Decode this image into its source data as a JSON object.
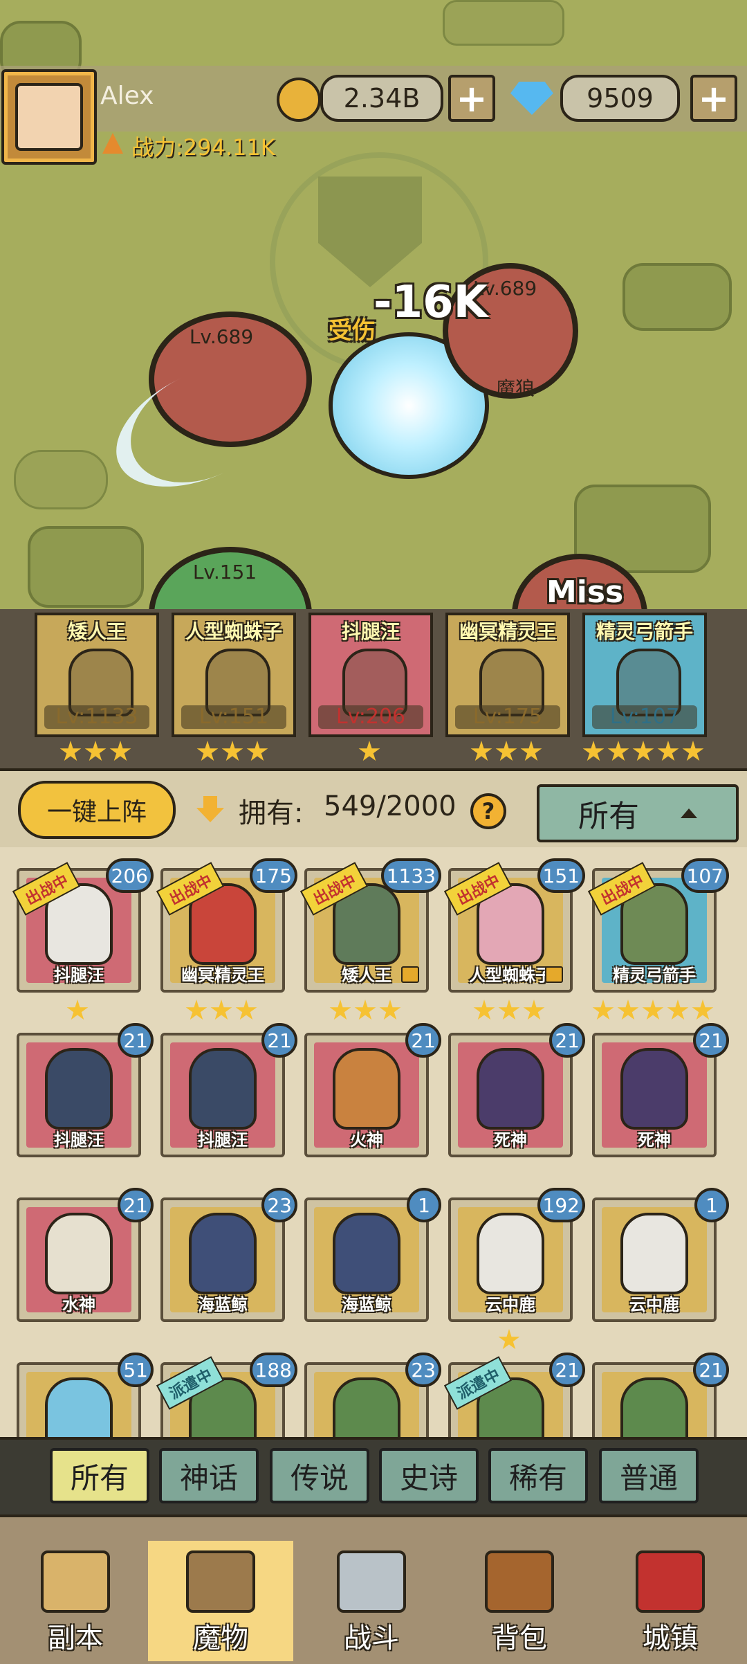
{
  "player": {
    "name": "Alex",
    "power_label": "战力:294.11K",
    "gold": "2.34B",
    "gems": "9509",
    "plus": "+"
  },
  "battle": {
    "enemy_levels": [
      "Lv.689",
      "Lv.689",
      "Lv.689"
    ],
    "damage_text": "-16K",
    "damage_prefix": "受伤",
    "miss_text": "Miss",
    "enemy_label": "魔狼",
    "ally_level": "Lv.151"
  },
  "formation": [
    {
      "name": "矮人王",
      "level": "Lv:1133",
      "stars": 3,
      "color": "#c7a85a"
    },
    {
      "name": "人型蜘蛛子",
      "level": "Lv:151",
      "stars": 3,
      "color": "#c7a85a"
    },
    {
      "name": "抖腿汪",
      "level": "Lv:206",
      "stars": 1,
      "color": "#cf6a74"
    },
    {
      "name": "幽冥精灵王",
      "level": "Lv:175",
      "stars": 3,
      "color": "#c7a85a"
    },
    {
      "name": "精灵弓箭手",
      "level": "Lv:107",
      "stars": 5,
      "color": "#5eb3c8"
    }
  ],
  "controls": {
    "deploy_label": "一键上阵",
    "owned_label": "拥有:",
    "owned_value": "549/2000",
    "help": "?",
    "filter_label": "所有"
  },
  "monsters": [
    {
      "name": "抖腿汪",
      "level": "206",
      "ribbon": "出战中",
      "stars": 1,
      "bg": "#cf6a74",
      "body": "#e8e6e0"
    },
    {
      "name": "幽冥精灵王",
      "level": "175",
      "ribbon": "出战中",
      "stars": 3,
      "bg": "#d8b65e",
      "body": "#c9453a"
    },
    {
      "name": "矮人王",
      "level": "1133",
      "ribbon": "出战中",
      "stars": 3,
      "bg": "#d8b65e",
      "body": "#5f7b5a",
      "locked": true
    },
    {
      "name": "人型蜘蛛子",
      "level": "151",
      "ribbon": "出战中",
      "stars": 3,
      "bg": "#d8b65e",
      "body": "#e3a7b5",
      "locked": true
    },
    {
      "name": "精灵弓箭手",
      "level": "107",
      "ribbon": "出战中",
      "stars": 5,
      "bg": "#5eb3c8",
      "body": "#6e8a55"
    },
    {
      "name": "抖腿汪",
      "level": "21",
      "stars": 0,
      "bg": "#cf6a74",
      "body": "#3a4a66"
    },
    {
      "name": "抖腿汪",
      "level": "21",
      "stars": 0,
      "bg": "#cf6a74",
      "body": "#3a4a66"
    },
    {
      "name": "火神",
      "level": "21",
      "stars": 0,
      "bg": "#cf6a74",
      "body": "#c9823f"
    },
    {
      "name": "死神",
      "level": "21",
      "stars": 0,
      "bg": "#cf6a74",
      "body": "#4b3c6a"
    },
    {
      "name": "死神",
      "level": "21",
      "stars": 0,
      "bg": "#cf6a74",
      "body": "#4b3c6a"
    },
    {
      "name": "水神",
      "level": "21",
      "stars": 0,
      "bg": "#cf6a74",
      "body": "#e6e0cf"
    },
    {
      "name": "海蓝鲸",
      "level": "23",
      "stars": 0,
      "bg": "#d8b65e",
      "body": "#3f4f78"
    },
    {
      "name": "海蓝鲸",
      "level": "1",
      "stars": 0,
      "bg": "#d8b65e",
      "body": "#3f4f78"
    },
    {
      "name": "云中鹿",
      "level": "192",
      "stars": 1,
      "bg": "#d8b65e",
      "body": "#e8e6e0"
    },
    {
      "name": "云中鹿",
      "level": "1",
      "stars": 0,
      "bg": "#d8b65e",
      "body": "#e8e6e0"
    },
    {
      "name": "",
      "level": "51",
      "stars": 0,
      "bg": "#d8b65e",
      "body": "#7ac4e0"
    },
    {
      "name": "",
      "level": "188",
      "ribbon2": "派遣中",
      "stars": 0,
      "bg": "#d8b65e",
      "body": "#5d8a4d"
    },
    {
      "name": "",
      "level": "23",
      "stars": 0,
      "bg": "#d8b65e",
      "body": "#5d8a4d"
    },
    {
      "name": "",
      "level": "21",
      "ribbon2": "派遣中",
      "stars": 0,
      "bg": "#d8b65e",
      "body": "#5d8a4d"
    },
    {
      "name": "",
      "level": "21",
      "stars": 0,
      "bg": "#d8b65e",
      "body": "#5d8a4d"
    }
  ],
  "rarity_tabs": [
    "所有",
    "神话",
    "传说",
    "史诗",
    "稀有",
    "普通"
  ],
  "nav": [
    "副本",
    "魔物",
    "战斗",
    "背包",
    "城镇"
  ],
  "active_nav": 1,
  "active_rarity": 0
}
